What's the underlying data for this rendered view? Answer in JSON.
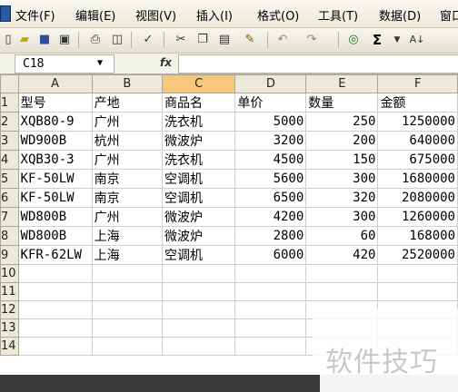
{
  "menu": [
    {
      "id": "file",
      "label": "文件(F)"
    },
    {
      "id": "edit",
      "label": "编辑(E)"
    },
    {
      "id": "view",
      "label": "视图(V)"
    },
    {
      "id": "insert",
      "label": "插入(I)"
    },
    {
      "id": "format",
      "label": "格式(O)"
    },
    {
      "id": "tools",
      "label": "工具(T)"
    },
    {
      "id": "data",
      "label": "数据(D)"
    },
    {
      "id": "window",
      "label": "窗口"
    }
  ],
  "toolbar": {
    "icons": [
      "new-icon",
      "open-icon",
      "save-icon",
      "permission-icon",
      "print-icon",
      "print-preview-icon",
      "spelling-icon",
      "cut-icon",
      "copy-icon",
      "paste-icon",
      "format-painter-icon",
      "undo-icon",
      "redo-icon",
      "hyperlink-icon",
      "autosum-icon",
      "sort-ascending-icon"
    ],
    "sum_symbol": "Σ",
    "sort_label": "A↓"
  },
  "formula_bar": {
    "cell_ref": "C18",
    "fx_label": "fx",
    "content": ""
  },
  "grid": {
    "columns": [
      "A",
      "B",
      "C",
      "D",
      "E",
      "F"
    ],
    "selected_column": "C",
    "rows": [
      {
        "num": "1",
        "cells": [
          "型号",
          "产地",
          "商品名",
          "单价",
          "数量",
          "金额"
        ]
      },
      {
        "num": "2",
        "cells": [
          "XQB80-9",
          "广州",
          "洗衣机",
          "5000",
          "250",
          "1250000"
        ]
      },
      {
        "num": "3",
        "cells": [
          "WD900B",
          "杭州",
          "微波炉",
          "3200",
          "200",
          "640000"
        ]
      },
      {
        "num": "4",
        "cells": [
          "XQB30-3",
          "广州",
          "洗衣机",
          "4500",
          "150",
          "675000"
        ]
      },
      {
        "num": "5",
        "cells": [
          "KF-50LW",
          "南京",
          "空调机",
          "5600",
          "300",
          "1680000"
        ]
      },
      {
        "num": "6",
        "cells": [
          "KF-50LW",
          "南京",
          "空调机",
          "6500",
          "320",
          "2080000"
        ]
      },
      {
        "num": "7",
        "cells": [
          "WD800B",
          "广州",
          "微波炉",
          "4200",
          "300",
          "1260000"
        ]
      },
      {
        "num": "8",
        "cells": [
          "WD800B",
          "上海",
          "微波炉",
          "2800",
          "60",
          "168000"
        ]
      },
      {
        "num": "9",
        "cells": [
          "KFR-62LW",
          "上海",
          "空调机",
          "6000",
          "420",
          "2520000"
        ]
      },
      {
        "num": "10",
        "cells": [
          "",
          "",
          "",
          "",
          "",
          ""
        ]
      },
      {
        "num": "11",
        "cells": [
          "",
          "",
          "",
          "",
          "",
          ""
        ]
      },
      {
        "num": "12",
        "cells": [
          "",
          "",
          "",
          "",
          "",
          ""
        ]
      },
      {
        "num": "13",
        "cells": [
          "",
          "",
          "",
          "",
          "",
          ""
        ]
      },
      {
        "num": "14",
        "cells": [
          "",
          "",
          "",
          "",
          "",
          ""
        ]
      }
    ]
  },
  "watermark": "软件技巧"
}
